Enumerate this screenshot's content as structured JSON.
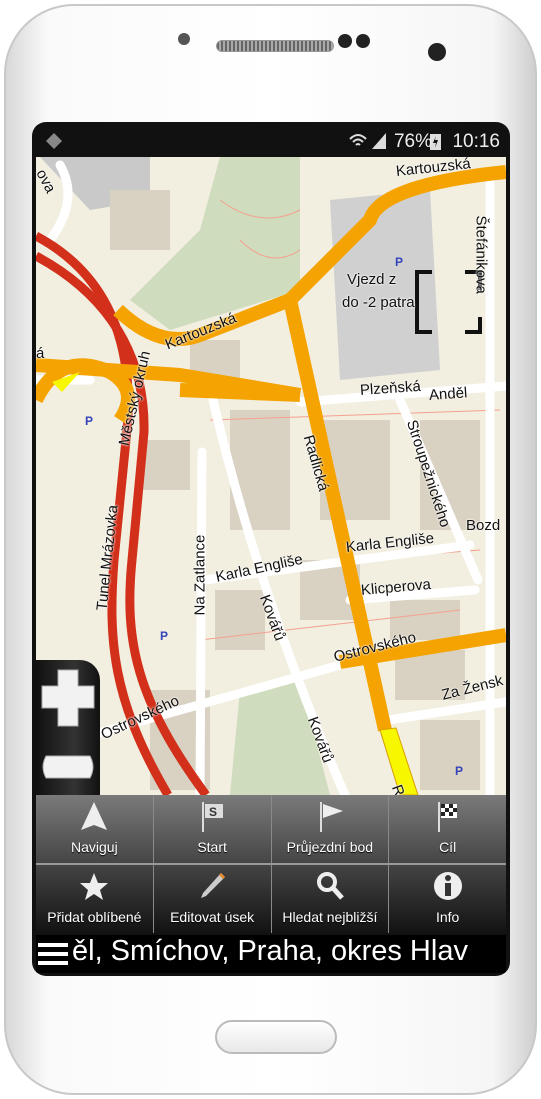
{
  "status_bar": {
    "battery": "76%",
    "time": "10:16",
    "icons": [
      "app-notification-icon",
      "wifi-icon",
      "signal-icon",
      "battery-charging-icon"
    ]
  },
  "map": {
    "labels": {
      "ova": "ova",
      "kartouzska_top": "Kartouzská",
      "stefanikova": "Štefánikova",
      "vjezd1": "Vjezd z",
      "vjezd2": "do -2 patra",
      "kartouzska_mid": "Kartouzská",
      "mestsky": "Městský okruh",
      "tunel": "Tunel Mrázovka",
      "radlicka": "Radlická",
      "plzenska": "Plzeňská",
      "andel": "Anděl",
      "stroupeznickeho": "Stroupežnického",
      "bozd": "Bozd",
      "karla1": "Karla Engliše",
      "karla2": "Karla Engliše",
      "zatlance": "Na Zatlance",
      "kovaru1": "Kovářů",
      "kovaru2": "Kovářů",
      "klicperova": "Klicperova",
      "ostrovskeho1": "Ostrovského",
      "ostrovskeho2": "Ostrovského",
      "zazensk": "Za Žensk",
      "ra": "Ra",
      "a": "á"
    },
    "colors": {
      "background": "#f2eee0",
      "primary_road": "#f5a300",
      "motorway": "#d2301a",
      "building": "#d9d1c1",
      "park": "#cfdcbd",
      "highlight": "#f7f700"
    }
  },
  "menu": {
    "row1": [
      {
        "label": "Naviguj",
        "icon": "navigate-arrow-icon"
      },
      {
        "label": "Start",
        "icon": "start-flag-icon"
      },
      {
        "label": "Průjezdní bod",
        "icon": "waypoint-flag-icon"
      },
      {
        "label": "Cíl",
        "icon": "finish-flag-icon"
      }
    ],
    "row2": [
      {
        "label": "Přidat oblíbené",
        "icon": "star-icon"
      },
      {
        "label": "Editovat úsek",
        "icon": "pencil-icon"
      },
      {
        "label": "Hledat nejbližší",
        "icon": "search-icon"
      },
      {
        "label": "Info",
        "icon": "info-icon"
      }
    ]
  },
  "address_bar": {
    "text": "ěl, Smíchov, Praha, okres Hlav"
  }
}
